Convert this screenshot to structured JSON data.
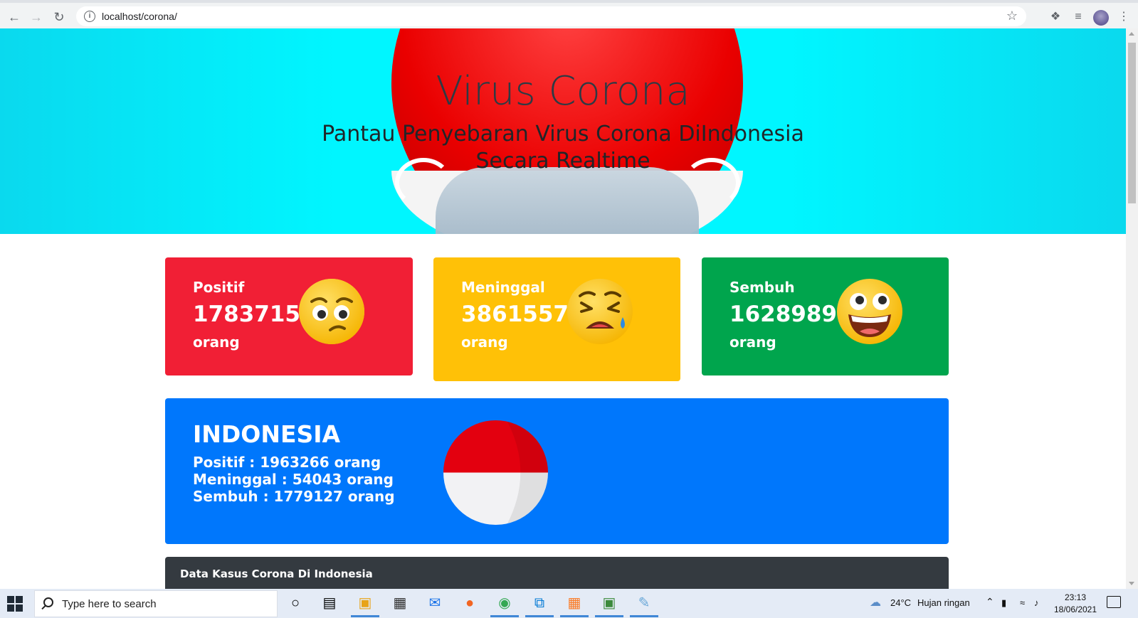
{
  "browser": {
    "url": "localhost/corona/"
  },
  "hero": {
    "title": "Virus Corona",
    "subtitle": "Pantau Penyebaran Virus Corona DiIndonesia Secara Realtime"
  },
  "cards": {
    "positif": {
      "label": "Positif",
      "value": "178371510",
      "unit": "orang",
      "icon": "worried-face-icon"
    },
    "meninggal": {
      "label": "Meninggal",
      "value": "3861557",
      "unit": "orang",
      "icon": "crying-face-icon"
    },
    "sembuh": {
      "label": "Sembuh",
      "value": "162898968",
      "unit": "orang",
      "icon": "grinning-face-icon"
    }
  },
  "indonesia": {
    "title": "INDONESIA",
    "positif": "Positif : 1963266 orang",
    "meninggal": "Meninggal : 54043 orang",
    "sembuh": "Sembuh : 1779127 orang",
    "icon": "indonesia-flag-icon"
  },
  "table": {
    "title": "Data Kasus Corona Di Indonesia"
  },
  "taskbar": {
    "search_placeholder": "Type here to search",
    "weather_temp": "24°C",
    "weather_desc": "Hujan ringan",
    "time": "23:13",
    "date": "18/06/2021"
  },
  "colors": {
    "positif": "#f11f35",
    "meninggal": "#ffc107",
    "sembuh": "#00a54d",
    "indonesia": "#0077fc",
    "table_header": "#343a40",
    "hero_bg": "#00f6ff"
  }
}
